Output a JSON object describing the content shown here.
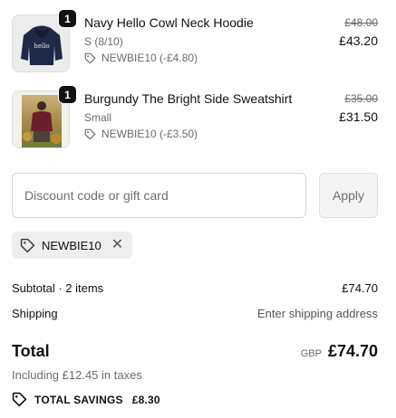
{
  "line_items": [
    {
      "quantity": "1",
      "title": "Navy Hello Cowl Neck Hoodie",
      "variant": "S (8/10)",
      "discount_label": "NEWBIE10 (-£4.80)",
      "compare_price": "£48.00",
      "final_price": "£43.20"
    },
    {
      "quantity": "1",
      "title": "Burgundy The Bright Side Sweatshirt",
      "variant": "Small",
      "discount_label": "NEWBIE10 (-£3.50)",
      "compare_price": "£35.00",
      "final_price": "£31.50"
    }
  ],
  "discount": {
    "placeholder": "Discount code or gift card",
    "apply_label": "Apply",
    "applied_code": "NEWBIE10"
  },
  "summary": {
    "subtotal_label": "Subtotal · 2 items",
    "subtotal_value": "£74.70",
    "shipping_label": "Shipping",
    "shipping_value": "Enter shipping address",
    "total_label": "Total",
    "currency": "GBP",
    "total_value": "£74.70",
    "taxes_note": "Including £12.45 in taxes",
    "savings_label": "TOTAL SAVINGS",
    "savings_value": "£8.30"
  }
}
